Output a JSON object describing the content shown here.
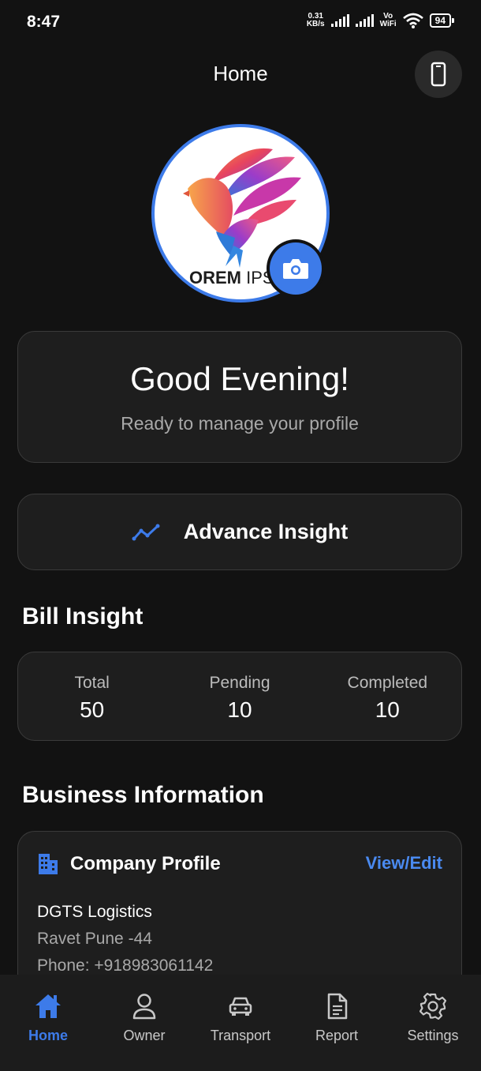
{
  "status_bar": {
    "time": "8:47",
    "speed_value": "0.31",
    "speed_unit": "KB/s",
    "vo_label": "Vo",
    "wifi_label": "WiFi",
    "battery": "94"
  },
  "header": {
    "title": "Home",
    "device_icon": "phone-icon"
  },
  "profile": {
    "logo_text_bold": "OREM",
    "logo_text_light": " IPS",
    "camera_icon": "camera-icon"
  },
  "greeting": {
    "title": "Good Evening!",
    "subtitle": "Ready to manage your profile"
  },
  "advance_insight": {
    "label": "Advance Insight",
    "icon": "trend-line-icon"
  },
  "bill_insight": {
    "title": "Bill Insight",
    "stats": [
      {
        "label": "Total",
        "value": "50"
      },
      {
        "label": "Pending",
        "value": "10"
      },
      {
        "label": "Completed",
        "value": "10"
      }
    ]
  },
  "business_info": {
    "title": "Business Information",
    "company_profile": {
      "label": "Company Profile",
      "action": "View/Edit",
      "name": "DGTS Logistics",
      "address": "Ravet Pune -44",
      "phone": "Phone: +918983061142"
    }
  },
  "bottom_nav": {
    "items": [
      {
        "label": "Home",
        "icon": "home-icon",
        "active": true
      },
      {
        "label": "Owner",
        "icon": "person-icon",
        "active": false
      },
      {
        "label": "Transport",
        "icon": "car-icon",
        "active": false
      },
      {
        "label": "Report",
        "icon": "document-icon",
        "active": false
      },
      {
        "label": "Settings",
        "icon": "gear-icon",
        "active": false
      }
    ]
  },
  "colors": {
    "accent": "#3d7be9",
    "background": "#121212",
    "card": "#1e1e1e"
  }
}
